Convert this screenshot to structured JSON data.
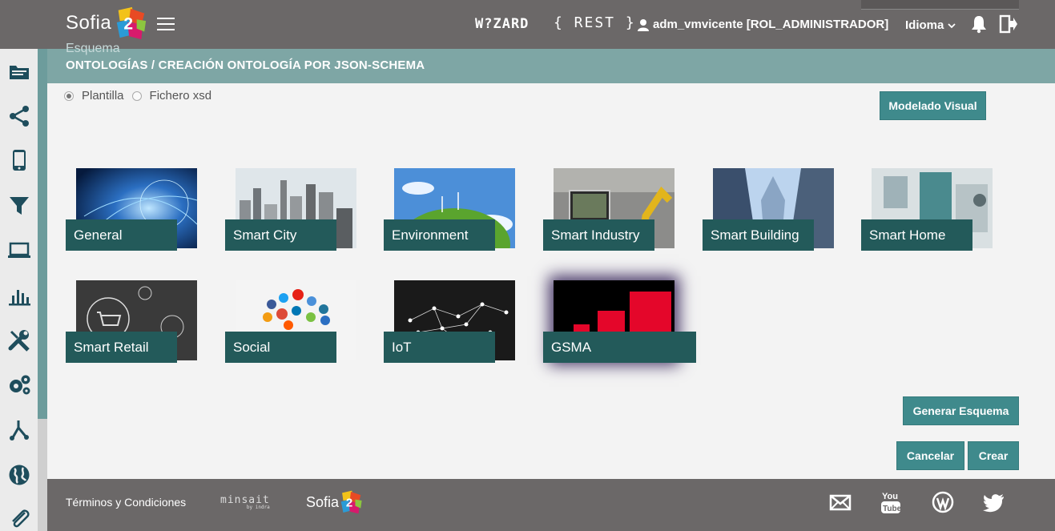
{
  "header": {
    "logo_text": "Sofia",
    "logo_number": "2",
    "wizard": "W?ZARD",
    "rest": "{ REST }",
    "user": "adm_vmvicente [ROL_ADMINISTRADOR]",
    "language": "Idioma"
  },
  "page": {
    "ghost_title": "Esquema",
    "title": "ONTOLOGÍAS / CREACIÓN ONTOLOGÍA POR JSON-SCHEMA"
  },
  "source_options": [
    {
      "label": "Plantilla",
      "selected": true
    },
    {
      "label": "Fichero xsd",
      "selected": false
    }
  ],
  "buttons": {
    "visual": "Modelado Visual",
    "generate": "Generar Esquema",
    "cancel": "Cancelar",
    "create": "Crear"
  },
  "templates": [
    {
      "label": "General",
      "icon": "network-globe-image"
    },
    {
      "label": "Smart City",
      "icon": "city-skyline-image"
    },
    {
      "label": "Environment",
      "icon": "green-planet-image"
    },
    {
      "label": "Smart Industry",
      "icon": "robot-arm-image"
    },
    {
      "label": "Smart Building",
      "icon": "skyscrapers-image"
    },
    {
      "label": "Smart Home",
      "icon": "home-interior-image"
    },
    {
      "label": "Smart Retail",
      "icon": "shopping-cart-image"
    },
    {
      "label": "Social",
      "icon": "social-icons-image"
    },
    {
      "label": "IoT",
      "icon": "iot-network-image"
    },
    {
      "label": "GSMA",
      "icon": "gsma-bars-image"
    }
  ],
  "footer": {
    "terms": "Términos y Condiciones",
    "minsait": "minsait",
    "minsait_sub": "by indra",
    "logo_text": "Sofia",
    "logo_number": "2"
  },
  "colors": {
    "header_bg": "#6b6868",
    "accent": "#3f8a8c",
    "tile_label": "#235a5a",
    "title_band": "#7ea6a5"
  }
}
